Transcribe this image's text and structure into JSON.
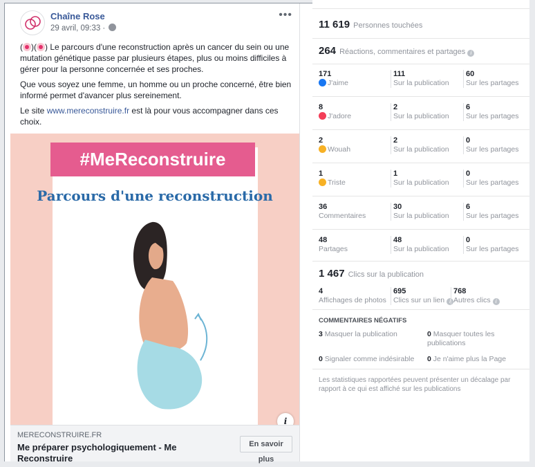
{
  "post": {
    "page_name": "Chaîne Rose",
    "date": "29 avril, 09:33 ·",
    "more": "•••",
    "paragraph1": ") Le parcours d'une reconstruction après un cancer du sein ou une mutation génétique passe par plusieurs étapes, plus ou moins difficiles à gérer pour la personne concernée et ses proches.",
    "paragraph2": "Que vous soyez une femme, un homme ou un proche concerné, être bien informé permet d'avancer plus sereinement.",
    "paragraph3_pre": "Le site ",
    "paragraph3_link": "www.mereconstruire.fr",
    "paragraph3_post": " est là pour vous accompagner dans ces choix.",
    "image_hashtag": "#MeReconstruire",
    "image_title": "Parcours d'une reconstruction",
    "info_glyph": "i",
    "link_domain": "MERECONSTRUIRE.FR",
    "link_title": "Me préparer psychologiquement - Me Reconstruire",
    "cta_label": "En savoir plus"
  },
  "stats": {
    "reach_value": "11 619",
    "reach_label": "Personnes touchées",
    "engagement_value": "264",
    "engagement_label": "Réactions, commentaires et partages",
    "rows": [
      {
        "v1": "171",
        "l1": "J'aime",
        "v2": "111",
        "l2": "Sur la publication",
        "v3": "60",
        "l3": "Sur les partages"
      },
      {
        "v1": "8",
        "l1": "J'adore",
        "v2": "2",
        "l2": "Sur la publication",
        "v3": "6",
        "l3": "Sur les partages"
      },
      {
        "v1": "2",
        "l1": "Wouah",
        "v2": "2",
        "l2": "Sur la publication",
        "v3": "0",
        "l3": "Sur les partages"
      },
      {
        "v1": "1",
        "l1": "Triste",
        "v2": "1",
        "l2": "Sur la publication",
        "v3": "0",
        "l3": "Sur les partages"
      },
      {
        "v1": "36",
        "l1": "Commentaires",
        "v2": "30",
        "l2": "Sur la publication",
        "v3": "6",
        "l3": "Sur les partages"
      },
      {
        "v1": "48",
        "l1": "Partages",
        "v2": "48",
        "l2": "Sur la publication",
        "v3": "0",
        "l3": "Sur les partages"
      }
    ],
    "clicks_value": "1 467",
    "clicks_label": "Clics sur la publication",
    "clicks": {
      "v1": "4",
      "l1": "Affichages de photos",
      "v2": "695",
      "l2": "Clics sur un lien",
      "v3": "768",
      "l3": "Autres clics"
    },
    "negative_title": "COMMENTAIRES NÉGATIFS",
    "neg": {
      "hide_post_v": "3",
      "hide_post_l": "Masquer la publication",
      "hide_all_v": "0",
      "hide_all_l": "Masquer toutes les publications",
      "spam_v": "0",
      "spam_l": "Signaler comme indésirable",
      "unlike_v": "0",
      "unlike_l": "Je n'aime plus la Page"
    },
    "footnote": "Les statistiques rapportées peuvent présenter un décalage par rapport à ce qui est affiché sur les publications"
  },
  "colors": {
    "link": "#385898",
    "hashtag_bg": "#e55c8f",
    "image_bg": "#f7cfc5",
    "title_blue": "#2a6aa8"
  }
}
